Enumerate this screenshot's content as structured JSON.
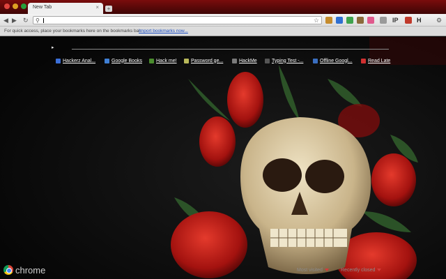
{
  "window": {
    "tab_title": "New Tab",
    "tab_close": "×",
    "new_tab": "+"
  },
  "toolbar": {
    "back_glyph": "◀",
    "forward_glyph": "▶",
    "reload_glyph": "↻",
    "search_glyph": "⚲",
    "star_glyph": "☆",
    "wrench_glyph": "⚙",
    "extensions": [
      {
        "name": "photo-extension-icon",
        "color": "#c58b2c"
      },
      {
        "name": "globe-extension-icon",
        "color": "#2f6fd1"
      },
      {
        "name": "refresh-extension-icon",
        "color": "#3fa34d"
      },
      {
        "name": "owl-extension-icon",
        "color": "#8b6a3a"
      },
      {
        "name": "heart-extension-icon",
        "color": "#e05a8d"
      },
      {
        "name": "page-extension-icon",
        "color": "#9a9a9a"
      },
      {
        "name": "ip-extension-icon",
        "color": "#333333",
        "text": "IP"
      },
      {
        "name": "card-extension-icon",
        "color": "#c0392b"
      },
      {
        "name": "h-extension-icon",
        "color": "#222222",
        "text": "H"
      }
    ]
  },
  "bookmarks_bar": {
    "hint": "For quick access, place your bookmarks here on the bookmarks bar.",
    "import_link": "Import bookmarks now..."
  },
  "ntp": {
    "section_arrow": "▸",
    "apps": [
      {
        "label": "Hackerz Anal...",
        "icon": "hackerz-icon",
        "color": "#3b6fd8"
      },
      {
        "label": "Google Books",
        "icon": "google-books-icon",
        "color": "#3f7fd4"
      },
      {
        "label": "Hack me!",
        "icon": "hack-me-icon",
        "color": "#4a8c2e"
      },
      {
        "label": "Password ge...",
        "icon": "password-generator-icon",
        "color": "#b8b85a"
      },
      {
        "label": "HackMe",
        "icon": "hackme-icon",
        "color": "#7a7a7a"
      },
      {
        "label": "Typing Test -...",
        "icon": "typing-test-icon",
        "color": "#555555"
      },
      {
        "label": "Offline Googl...",
        "icon": "offline-google-icon",
        "color": "#3a6ec0"
      },
      {
        "label": "Read Late",
        "icon": "read-later-icon",
        "color": "#d03030"
      }
    ],
    "brand": "chrome",
    "footer": [
      {
        "label": "Most visited",
        "name": "most-visited-tab"
      },
      {
        "label": "Recently closed",
        "name": "recently-closed-tab"
      }
    ]
  }
}
